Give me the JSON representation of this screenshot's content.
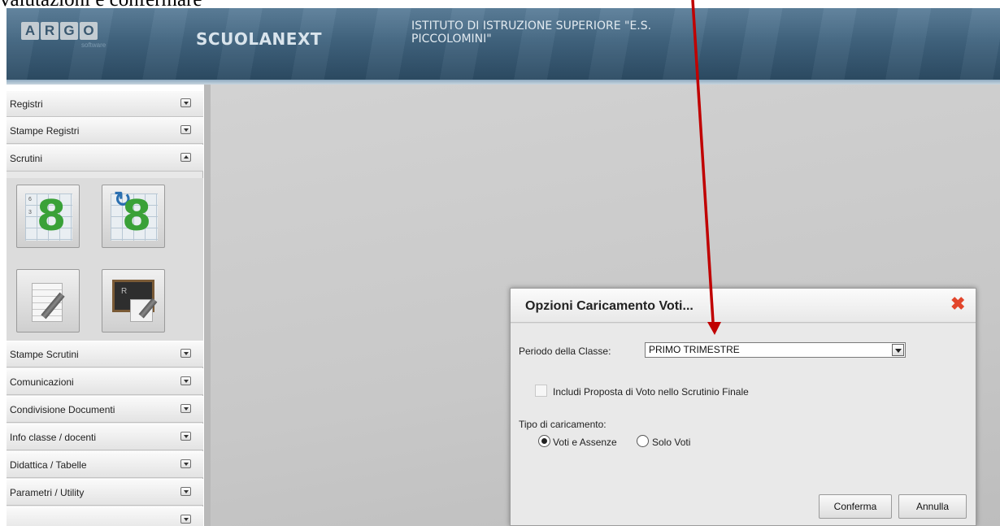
{
  "caption": "valutazioni e confermare",
  "header": {
    "logo_letters": [
      "A",
      "R",
      "G",
      "O"
    ],
    "logo_subtitle": "software",
    "brand": "SCUOLANEXT",
    "school": "ISTITUTO DI ISTRUZIONE SUPERIORE \"E.S.\nPICCOLOMINI\""
  },
  "sidebar": {
    "items": [
      {
        "label": "Registri",
        "state": "collapsed"
      },
      {
        "label": "Stampe Registri",
        "state": "collapsed"
      },
      {
        "label": "Scrutini",
        "state": "expanded"
      },
      {
        "label": "Stampe Scrutini",
        "state": "collapsed"
      },
      {
        "label": "Comunicazioni",
        "state": "collapsed"
      },
      {
        "label": "Condivisione Documenti",
        "state": "collapsed"
      },
      {
        "label": "Info classe / docenti",
        "state": "collapsed"
      },
      {
        "label": "Didattica / Tabelle",
        "state": "collapsed"
      },
      {
        "label": "Parametri / Utility",
        "state": "collapsed"
      }
    ],
    "scrutini_tiles": [
      {
        "icon": "grade-grid-icon",
        "glyph": "8",
        "small_marks": [
          "6",
          "3"
        ]
      },
      {
        "icon": "reload-grades-icon",
        "glyph": "8"
      },
      {
        "icon": "notes-pencil-icon"
      },
      {
        "icon": "blackboard-icon",
        "glyph": "R"
      }
    ]
  },
  "dialog": {
    "title": "Opzioni Caricamento Voti...",
    "period_label": "Periodo della Classe:",
    "period_value": "PRIMO TRIMESTRE",
    "include_label": "Includi Proposta di Voto nello Scrutinio Finale",
    "include_checked": false,
    "load_type_label": "Tipo di caricamento:",
    "load_options": [
      {
        "label": "Voti e Assenze",
        "selected": true
      },
      {
        "label": "Solo Voti",
        "selected": false
      }
    ],
    "confirm_label": "Conferma",
    "cancel_label": "Annulla"
  },
  "colors": {
    "header": "#41647f",
    "annotation_arrow": "#c00000",
    "close_icon": "#e2452b",
    "grade_green": "#3aa138"
  }
}
